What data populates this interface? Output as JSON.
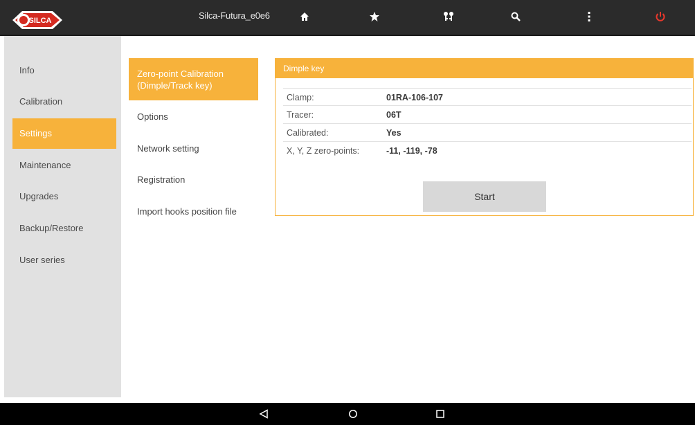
{
  "topbar": {
    "device_name": "Silca-Futura_e0e6",
    "icons": [
      "home-icon",
      "star-icon",
      "keys-icon",
      "search-icon",
      "more-icon",
      "power-icon"
    ],
    "power_color": "#e8382c"
  },
  "logo": {
    "text": "SILCA"
  },
  "sidebar": {
    "items": [
      {
        "label": "Info"
      },
      {
        "label": "Calibration"
      },
      {
        "label": "Settings",
        "active": true
      },
      {
        "label": "Maintenance"
      },
      {
        "label": "Upgrades"
      },
      {
        "label": "Backup/Restore"
      },
      {
        "label": "User series"
      }
    ]
  },
  "submenu": {
    "items": [
      {
        "label": "Zero-point Calibration (Dimple/Track key)",
        "active": true
      },
      {
        "label": "Options"
      },
      {
        "label": "Network setting"
      },
      {
        "label": "Registration"
      },
      {
        "label": "Import hooks position file"
      }
    ]
  },
  "panel": {
    "title": "Dimple key",
    "rows": [
      {
        "key": "Clamp:",
        "value": "01RA-106-107"
      },
      {
        "key": "Tracer:",
        "value": "06T"
      },
      {
        "key": "Calibrated:",
        "value": "Yes"
      },
      {
        "key": "X, Y, Z zero-points:",
        "value": "-11, -119, -78"
      }
    ],
    "start_label": "Start"
  },
  "colors": {
    "accent": "#f7b23b",
    "topbar": "#2b2b2b",
    "sidebar": "#e1e1e1"
  },
  "navbar": {
    "icons": [
      "back-icon",
      "home-circle-icon",
      "recents-icon"
    ]
  }
}
